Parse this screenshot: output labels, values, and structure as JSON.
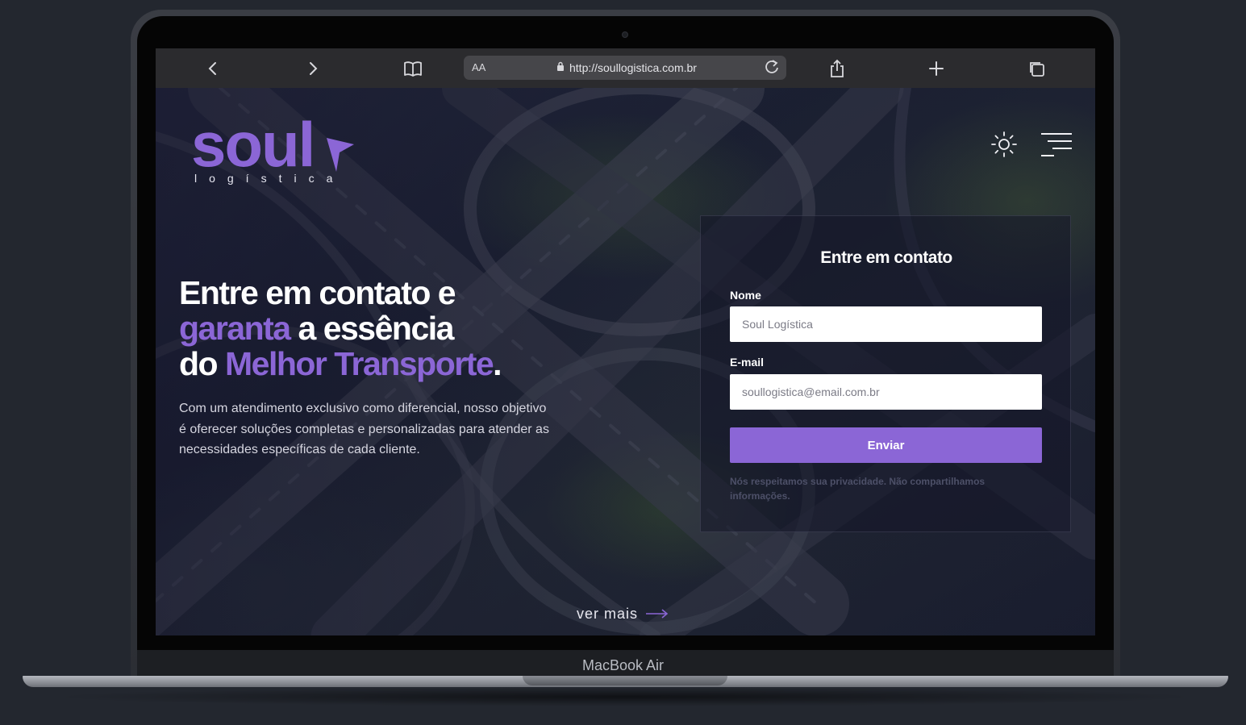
{
  "device": {
    "label": "MacBook Air"
  },
  "browser": {
    "reader_label": "AA",
    "url": "http://soullogistica.com.br",
    "icons": {
      "back": "chevron-left-icon",
      "forward": "chevron-right-icon",
      "bookmarks": "book-icon",
      "reload": "reload-icon",
      "share": "share-icon",
      "new_tab": "plus-icon",
      "tabs": "tabs-icon",
      "lock": "lock-icon"
    }
  },
  "site": {
    "logo": {
      "word": "soul",
      "subtitle": "logística"
    },
    "header": {
      "theme_icon": "sun-icon",
      "menu_icon": "menu-icon"
    },
    "hero": {
      "line1": "Entre em contato e",
      "line2_accent": "garanta",
      "line2_rest": " a essência",
      "line3_start": "do ",
      "line3_accent": "Melhor Transporte",
      "line3_end": ".",
      "text": "Com um atendimento exclusivo como diferencial, nosso objetivo é oferecer soluções completas e personalizadas para atender as necessidades específicas de cada cliente."
    },
    "ver_mais": "ver mais",
    "contact": {
      "title": "Entre em contato",
      "name_label": "Nome",
      "name_placeholder": "Soul Logística",
      "email_label": "E-mail",
      "email_placeholder": "soullogistica@email.com.br",
      "submit": "Enviar",
      "privacy": "Nós respeitamos sua privacidade. Não compartilhamos informações."
    }
  },
  "colors": {
    "accent": "#8b66d6",
    "background": "#23272f"
  }
}
